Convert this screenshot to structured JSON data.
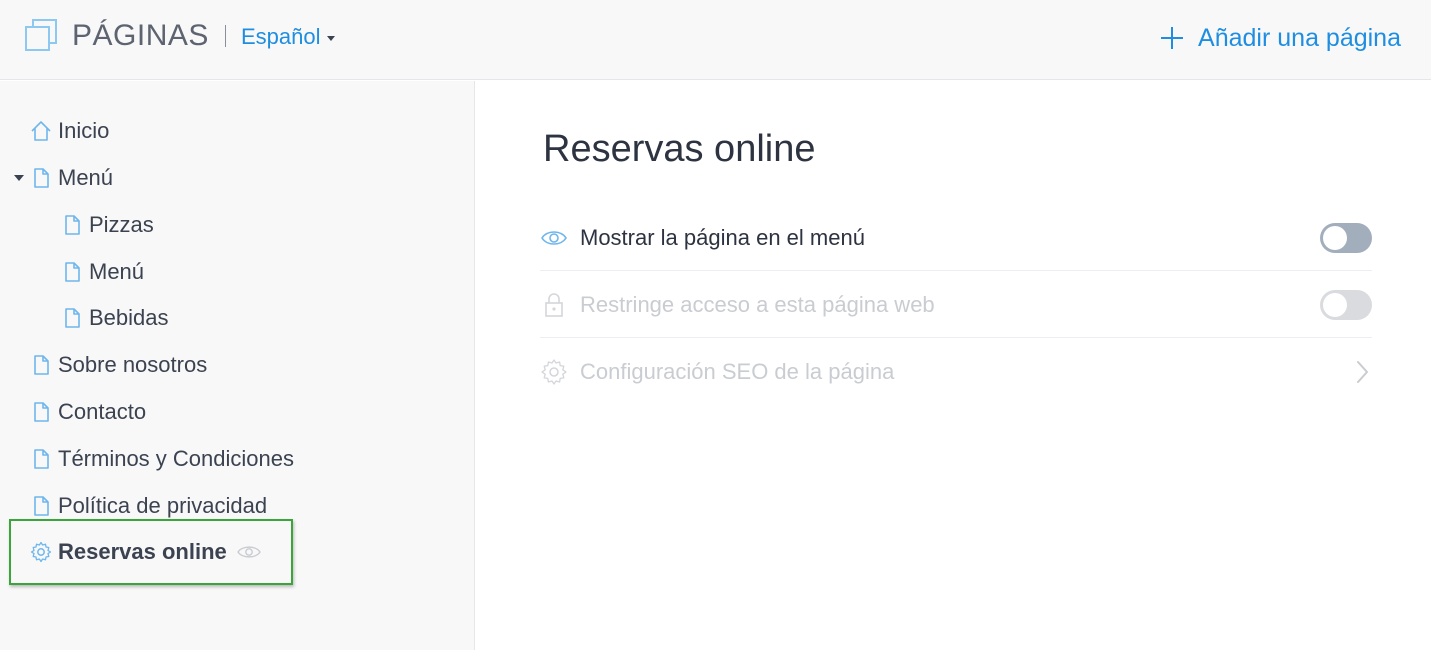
{
  "header": {
    "title": "PÁGINAS",
    "language": "Español",
    "add_page_label": "Añadir una página",
    "icons": [
      "pages-icon",
      "chevron-down-icon",
      "plus-icon"
    ]
  },
  "sidebar": {
    "items": [
      {
        "label": "Inicio",
        "icon": "home-icon"
      },
      {
        "label": "Menú",
        "icon": "page-icon",
        "expanded": true
      },
      {
        "label": "Pizzas",
        "icon": "page-icon"
      },
      {
        "label": "Menú",
        "icon": "page-icon"
      },
      {
        "label": "Bebidas",
        "icon": "page-icon"
      },
      {
        "label": "Sobre nosotros",
        "icon": "page-icon"
      },
      {
        "label": "Contacto",
        "icon": "page-icon"
      },
      {
        "label": "Términos y Condiciones",
        "icon": "page-icon"
      },
      {
        "label": "Política de privacidad",
        "icon": "page-icon"
      },
      {
        "label": "Reservas online",
        "icon": "gear-icon",
        "selected": true,
        "hidden_icon": "eye-icon"
      }
    ]
  },
  "main": {
    "title": "Reservas online",
    "settings": [
      {
        "label": "Mostrar la página en el menú",
        "icon": "eye-icon",
        "control": "toggle",
        "on": false,
        "enabled": true
      },
      {
        "label": "Restringe acceso a esta página web",
        "icon": "lock-icon",
        "control": "toggle",
        "on": false,
        "enabled": false
      },
      {
        "label": "Configuración SEO de la página",
        "icon": "gear-icon",
        "control": "chevron",
        "enabled": false
      }
    ]
  },
  "colors": {
    "accent": "#1f8ee0",
    "icon_blue": "#6fb6ec",
    "text": "#3b4250",
    "disabled_text": "#c9ccd1",
    "toggle_active_bg": "#a3aebd",
    "toggle_disabled_bg": "#d9dbdf",
    "highlight_border": "#3aa53a"
  }
}
